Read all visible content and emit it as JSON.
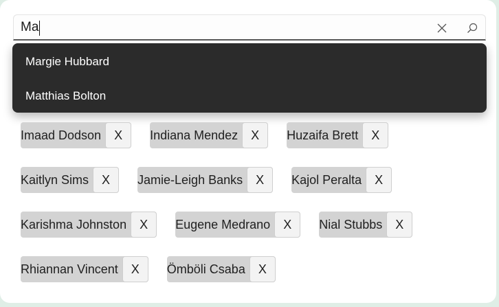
{
  "search": {
    "value": "Ma",
    "clear_icon": "close-icon",
    "search_icon": "search-icon"
  },
  "suggestions": [
    {
      "label": "Margie Hubbard"
    },
    {
      "label": "Matthias Bolton"
    }
  ],
  "tokens": [
    [
      {
        "label": "Imaad Dodson",
        "remove": "X"
      },
      {
        "label": "Indiana Mendez",
        "remove": "X"
      },
      {
        "label": "Huzaifa Brett",
        "remove": "X"
      }
    ],
    [
      {
        "label": "Kaitlyn Sims",
        "remove": "X"
      },
      {
        "label": "Jamie-Leigh Banks",
        "remove": "X"
      },
      {
        "label": "Kajol Peralta",
        "remove": "X"
      }
    ],
    [
      {
        "label": "Karishma Johnston",
        "remove": "X"
      },
      {
        "label": "Eugene Medrano",
        "remove": "X"
      },
      {
        "label": "Nial Stubbs",
        "remove": "X"
      }
    ],
    [
      {
        "label": "Rhiannan Vincent",
        "remove": "X"
      },
      {
        "label": "Ömböli Csaba",
        "remove": "X"
      }
    ]
  ],
  "colors": {
    "background": "#dfeee6",
    "card": "#ffffff",
    "dropdown": "#2b2b2b",
    "token": "#d3d3d3",
    "token_remove": "#f3f3f3"
  }
}
